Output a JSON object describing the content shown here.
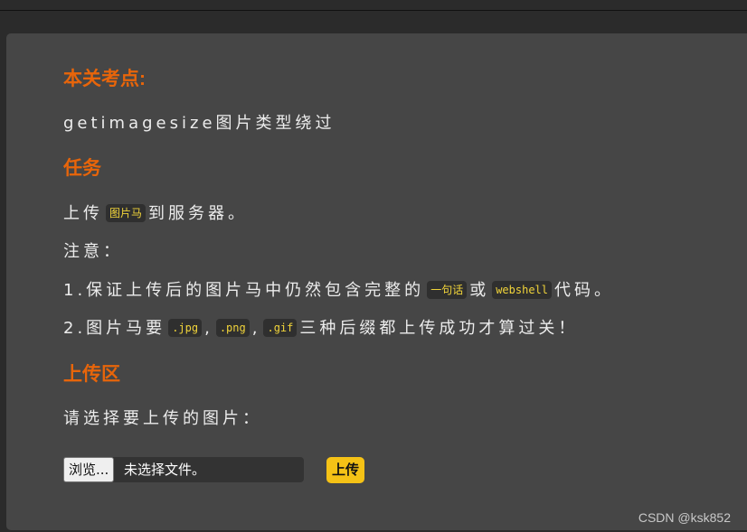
{
  "sections": {
    "focus": {
      "heading": "本关考点:",
      "text": "getimagesize图片类型绕过"
    },
    "task": {
      "heading": "任务",
      "line1": {
        "prefix": "上传",
        "code": "图片马",
        "suffix": "到服务器。"
      },
      "note_label": "注意：",
      "note1": {
        "prefix": "1.保证上传后的图片马中仍然包含完整的",
        "code1": "一句话",
        "middle": "或",
        "code2": "webshell",
        "suffix": "代码。"
      },
      "note2": {
        "prefix": "2.图片马要",
        "code1": ".jpg",
        "sep1": ",",
        "code2": ".png",
        "sep2": ",",
        "code3": ".gif",
        "suffix": "三种后缀都上传成功才算过关！"
      }
    },
    "upload": {
      "heading": "上传区",
      "prompt": "请选择要上传的图片：",
      "browse_label": "浏览...",
      "file_status": "未选择文件。",
      "submit_label": "上传"
    }
  },
  "watermark": "CSDN @ksk852",
  "colors": {
    "heading": "#e8650a",
    "code_text": "#f1d43a",
    "submit_bg": "#f5c216"
  }
}
